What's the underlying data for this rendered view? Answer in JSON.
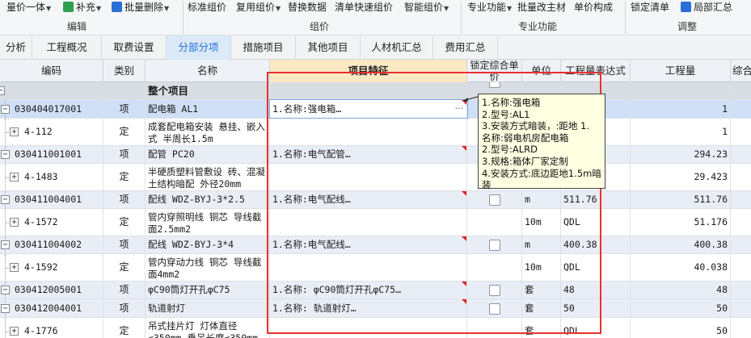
{
  "ribbon": {
    "buttons": [
      {
        "label": "量价一体",
        "caret": true
      },
      {
        "label": "补充",
        "caret": true
      },
      {
        "label": "批量删除",
        "caret": true
      },
      {
        "label": "标准组价"
      },
      {
        "label": "复用组价",
        "caret": true
      },
      {
        "label": "替换数据"
      },
      {
        "label": "清单快速组价"
      },
      {
        "label": "智能组价",
        "caret": true
      },
      {
        "label": "专业功能",
        "caret": true
      },
      {
        "label": "批量改主材"
      },
      {
        "label": "单价构成"
      },
      {
        "label": "锁定清单"
      },
      {
        "label": "局部汇总"
      }
    ],
    "groups": [
      "编辑",
      "组价",
      "专业功能",
      "调整"
    ],
    "colors": {
      "icon_green": "#2e9e4f",
      "icon_blue": "#2a6fd6",
      "icon_red": "#d33a2c"
    }
  },
  "tabs": [
    {
      "label": "分析"
    },
    {
      "label": "工程概况"
    },
    {
      "label": "取费设置"
    },
    {
      "label": "分部分项",
      "active": true
    },
    {
      "label": "措施项目"
    },
    {
      "label": "其他项目"
    },
    {
      "label": "人材机汇总"
    },
    {
      "label": "费用汇总"
    }
  ],
  "columns": {
    "code": "编码",
    "type": "类别",
    "name": "名称",
    "feature": "项目特征",
    "lock": "锁定综合单价",
    "unit": "单位",
    "expr": "工程量表达式",
    "qty": "工程量",
    "more": "综合"
  },
  "rows": [
    {
      "kind": "group",
      "code": "",
      "type": "",
      "name": "整个项目",
      "feature": "",
      "unit": "",
      "expr": "",
      "qty": ""
    },
    {
      "kind": "qd",
      "selected": true,
      "code": "030404017001",
      "type": "项",
      "name": "配电箱 AL1",
      "feature": "1.名称:强电箱…",
      "unit": "",
      "expr": "",
      "qty": "1"
    },
    {
      "kind": "de",
      "code": "4-112",
      "type": "定",
      "name": "成套配电箱安装 悬挂、嵌入式 半周长1.5m",
      "feature": "",
      "unit": "",
      "expr": "",
      "qty": "1"
    },
    {
      "kind": "qd",
      "code": "030411001001",
      "type": "项",
      "name": "配管 PC20",
      "feature": "1.名称:电气配管…",
      "unit": "",
      "expr": "",
      "qty": "294.23"
    },
    {
      "kind": "de",
      "code": "4-1483",
      "type": "定",
      "name": "半硬质塑料管敷设 砖、混凝土结构暗配 外径20mm",
      "feature": "",
      "unit": "",
      "expr": "",
      "qty": "29.423"
    },
    {
      "kind": "qd",
      "code": "030411004001",
      "type": "项",
      "name": "配线 WDZ-BYJ-3*2.5",
      "feature": "1.名称:电气配线…",
      "unit": "m",
      "expr": "511.76",
      "qty": "511.76"
    },
    {
      "kind": "de",
      "code": "4-1572",
      "type": "定",
      "name": "管内穿照明线 铜芯 导线截面2.5mm2",
      "feature": "",
      "unit": "10m",
      "expr": "QDL",
      "qty": "51.176"
    },
    {
      "kind": "qd",
      "code": "030411004002",
      "type": "项",
      "name": "配线 WDZ-BYJ-3*4",
      "feature": "1.名称:电气配线…",
      "unit": "m",
      "expr": "400.38",
      "qty": "400.38"
    },
    {
      "kind": "de",
      "code": "4-1592",
      "type": "定",
      "name": "管内穿动力线 铜芯 导线截面4mm2",
      "feature": "",
      "unit": "10m",
      "expr": "QDL",
      "qty": "40.038"
    },
    {
      "kind": "qd",
      "code": "030412005001",
      "type": "项",
      "name": "φC90筒灯开孔φC75",
      "feature": "1.名称: φC90筒灯开孔φC75…",
      "unit": "套",
      "expr": "48",
      "qty": "48"
    },
    {
      "kind": "qd",
      "code": "030412004001",
      "type": "项",
      "name": "轨道射灯",
      "feature": "1.名称: 轨道射灯…",
      "unit": "套",
      "expr": "50",
      "qty": "50"
    },
    {
      "kind": "de",
      "code": "4-1776",
      "type": "定",
      "name": "吊式挂片灯 灯体直径≤350mm 垂吊长度≤350mm",
      "feature": "",
      "unit": "套",
      "expr": "QDL",
      "qty": "50"
    }
  ],
  "tooltip": {
    "lines": [
      "1.名称:强电箱",
      "2.型号:AL1",
      "3.安装方式暗装，:距地 1.",
      "名称:弱电机房配电箱",
      "2.型号:ALRD",
      "3.规格:箱体厂家定制",
      "4.安装方式:底边距地1.5m暗装"
    ]
  }
}
